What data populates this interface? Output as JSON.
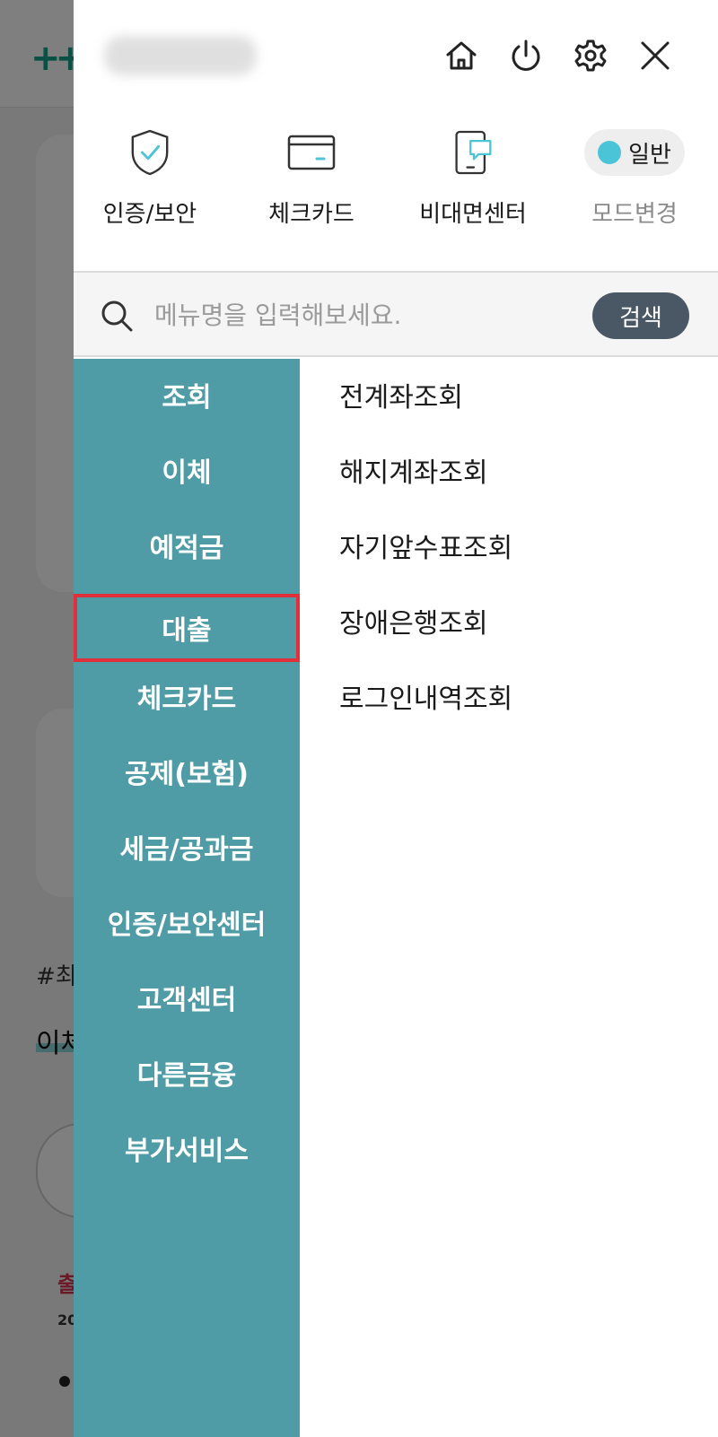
{
  "background": {
    "tag_text": "#최",
    "title_text": "이체",
    "red_text": "출",
    "small_text": "20"
  },
  "top_bar": {
    "icons": [
      "home-icon",
      "power-icon",
      "gear-icon",
      "close-icon"
    ]
  },
  "quick_menu": {
    "items": [
      {
        "label": "인증/보안",
        "icon": "shield-check-icon"
      },
      {
        "label": "체크카드",
        "icon": "card-icon"
      },
      {
        "label": "비대면센터",
        "icon": "phone-chat-icon"
      },
      {
        "label": "모드변경",
        "icon": "mode-toggle"
      }
    ],
    "mode_value": "일반"
  },
  "search": {
    "placeholder": "메뉴명을 입력해보세요.",
    "button_label": "검색"
  },
  "categories": [
    "조회",
    "이체",
    "예적금",
    "대출",
    "체크카드",
    "공제(보험)",
    "세금/공과금",
    "인증/보안센터",
    "고객센터",
    "다른금융",
    "부가서비스"
  ],
  "selected_category": "대출",
  "sub_items": [
    "전계좌조회",
    "해지계좌조회",
    "자기앞수표조회",
    "장애은행조회",
    "로그인내역조회"
  ],
  "colors": {
    "category_bg": "#4f9ca6",
    "highlight": "#e0303c",
    "search_button": "#4a5866",
    "mode_dot": "#4cc4d8"
  }
}
